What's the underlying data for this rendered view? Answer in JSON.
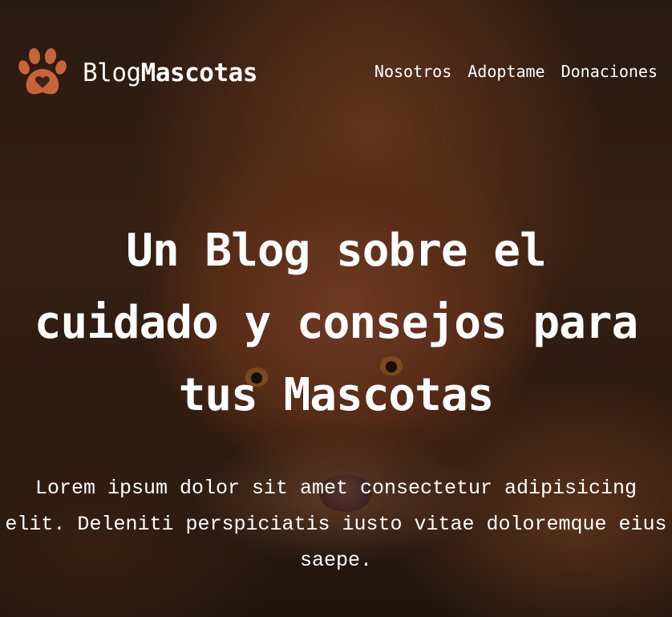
{
  "header": {
    "logo_icon": "paw-heart-icon",
    "brand_light": "Blog",
    "brand_bold": "Mascotas",
    "nav": [
      {
        "label": "Nosotros"
      },
      {
        "label": "Adoptame"
      },
      {
        "label": "Donaciones"
      }
    ]
  },
  "hero": {
    "background": "dog-lying-in-autumn-leaves-photo",
    "title": "Un Blog sobre el cuidado y consejos para tus Mascotas",
    "lead": "Lorem ipsum dolor sit amet consectetur adipisicing elit. Deleniti perspiciatis iusto vitae doloremque eius saepe."
  },
  "colors": {
    "accent": "#c8643a",
    "text": "#ffffff"
  }
}
